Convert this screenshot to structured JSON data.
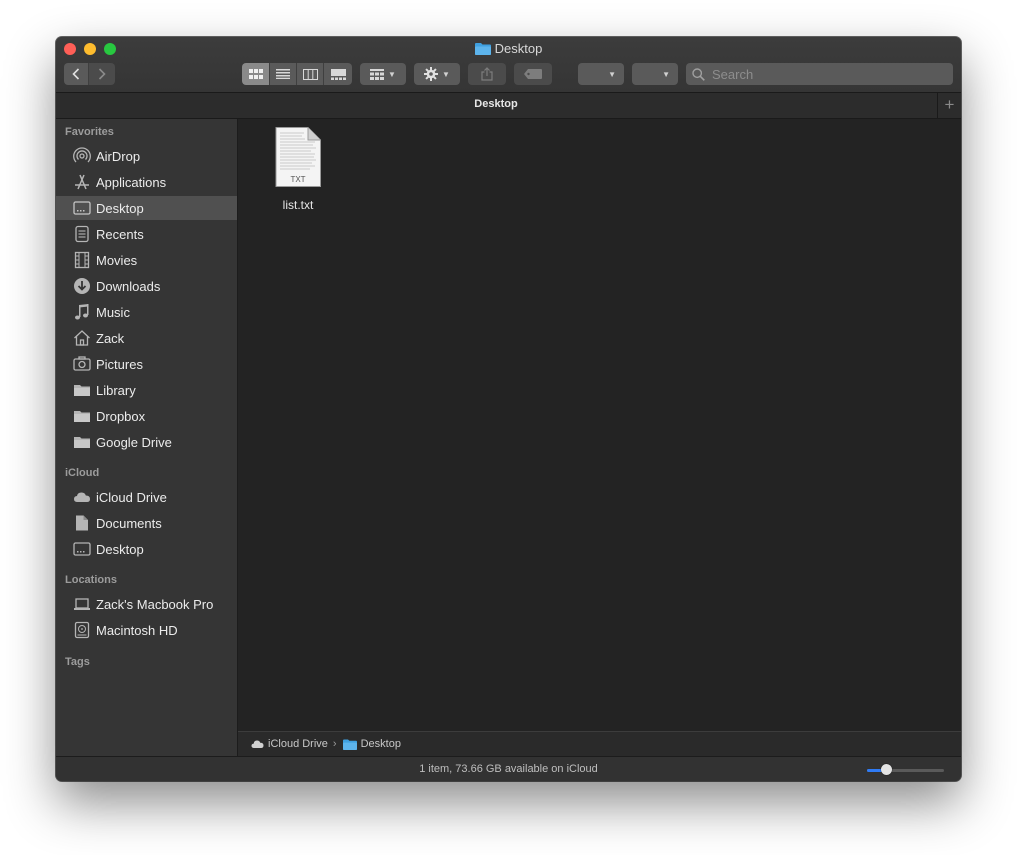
{
  "window": {
    "title": "Desktop"
  },
  "toolbar": {
    "view_modes": [
      "icon-view",
      "list-view",
      "column-view",
      "gallery-view"
    ],
    "active_view": "icon-view",
    "search": {
      "placeholder": "Search",
      "value": ""
    }
  },
  "tab": {
    "title": "Desktop"
  },
  "sidebar": {
    "sections": [
      {
        "heading": "Favorites",
        "items": [
          {
            "label": "AirDrop",
            "icon": "airdrop-icon"
          },
          {
            "label": "Applications",
            "icon": "applications-icon"
          },
          {
            "label": "Desktop",
            "icon": "desktop-icon",
            "selected": true
          },
          {
            "label": "Recents",
            "icon": "recents-icon"
          },
          {
            "label": "Movies",
            "icon": "movies-icon"
          },
          {
            "label": "Downloads",
            "icon": "downloads-icon"
          },
          {
            "label": "Music",
            "icon": "music-icon"
          },
          {
            "label": "Zack",
            "icon": "home-icon"
          },
          {
            "label": "Pictures",
            "icon": "pictures-icon"
          },
          {
            "label": "Library",
            "icon": "folder-icon"
          },
          {
            "label": "Dropbox",
            "icon": "folder-icon"
          },
          {
            "label": "Google Drive",
            "icon": "folder-icon"
          }
        ]
      },
      {
        "heading": "iCloud",
        "items": [
          {
            "label": "iCloud Drive",
            "icon": "cloud-icon"
          },
          {
            "label": "Documents",
            "icon": "documents-icon"
          },
          {
            "label": "Desktop",
            "icon": "desktop-icon"
          }
        ]
      },
      {
        "heading": "Locations",
        "items": [
          {
            "label": "Zack's Macbook Pro",
            "icon": "laptop-icon"
          },
          {
            "label": "Macintosh HD",
            "icon": "disk-icon"
          }
        ]
      },
      {
        "heading": "Tags",
        "items": []
      }
    ]
  },
  "files": [
    {
      "name": "list.txt",
      "type_badge": "TXT",
      "icon": "text-file-icon"
    }
  ],
  "path_bar": [
    {
      "label": "iCloud Drive",
      "icon": "cloud-icon"
    },
    {
      "label": "Desktop",
      "icon": "folder-blue-icon"
    }
  ],
  "status": {
    "text": "1 item, 73.66 GB available on iCloud"
  },
  "icon_size_slider": {
    "value": 0.25
  },
  "colors": {
    "accent": "#2f7bf5",
    "folder": "#3fa0e0",
    "selected_row": "#505050"
  }
}
